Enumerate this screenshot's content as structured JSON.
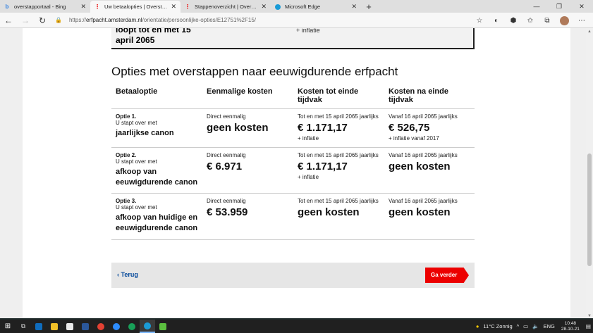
{
  "browser": {
    "tabs": [
      {
        "title": "overstapportaal - Bing",
        "active": false
      },
      {
        "title": "Uw betaalopties | Overstapportaal",
        "active": true
      },
      {
        "title": "Stappenoverzicht | Overstapportaal",
        "active": false
      },
      {
        "title": "Microsoft Edge",
        "active": false
      }
    ],
    "new_tab": "+",
    "url_scheme": "https://",
    "url_host": "erfpacht.amsterdam.nl",
    "url_path": "/orientatie/persoonlijke-opties/E12751%2F15/"
  },
  "top_fragment": {
    "left_text": "loopt tot en met 15 april 2065",
    "right_text": "+ inflatie"
  },
  "section_title": "Opties met overstappen naar eeuwigdurende erfpacht",
  "table": {
    "headers": [
      "Betaaloptie",
      "Eenmalige kosten",
      "Kosten tot einde tijdvak",
      "Kosten na einde tijdvak"
    ],
    "rows": [
      {
        "option": "Optie 1.",
        "sub": "U stapt over met",
        "name": "jaarlijkse canon",
        "once_label": "Direct eenmalig",
        "once_value": "geen kosten",
        "until_label": "Tot en met 15 april 2065 jaarlijks",
        "until_value": "€ 1.171,17",
        "until_note": "+ inflatie",
        "after_label": "Vanaf 16 april 2065 jaarlijks",
        "after_value": "€ 526,75",
        "after_note": "+ inflatie vanaf 2017"
      },
      {
        "option": "Optie 2.",
        "sub": "U stapt over met",
        "name": "afkoop van eeuwigdurende canon",
        "once_label": "Direct eenmalig",
        "once_value": "€ 6.971",
        "until_label": "Tot en met 15 april 2065 jaarlijks",
        "until_value": "€ 1.171,17",
        "until_note": "+ inflatie",
        "after_label": "Vanaf 16 april 2065 jaarlijks",
        "after_value": "geen kosten",
        "after_note": ""
      },
      {
        "option": "Optie 3.",
        "sub": "U stapt over met",
        "name": "afkoop van huidige en eeuwigdurende canon",
        "once_label": "Direct eenmalig",
        "once_value": "€ 53.959",
        "until_label": "Tot en met 15 april 2065 jaarlijks",
        "until_value": "geen kosten",
        "until_note": "",
        "after_label": "Vanaf 16 april 2065 jaarlijks",
        "after_value": "geen kosten",
        "after_note": ""
      }
    ]
  },
  "nav": {
    "back_label": "Terug",
    "next_label": "Ga verder"
  },
  "taskbar": {
    "weather": "11°C Zonnig",
    "language": "ENG",
    "time": "10:48",
    "date": "28-10-21"
  },
  "colors": {
    "accent_red": "#ec0000",
    "link_blue": "#004699"
  }
}
